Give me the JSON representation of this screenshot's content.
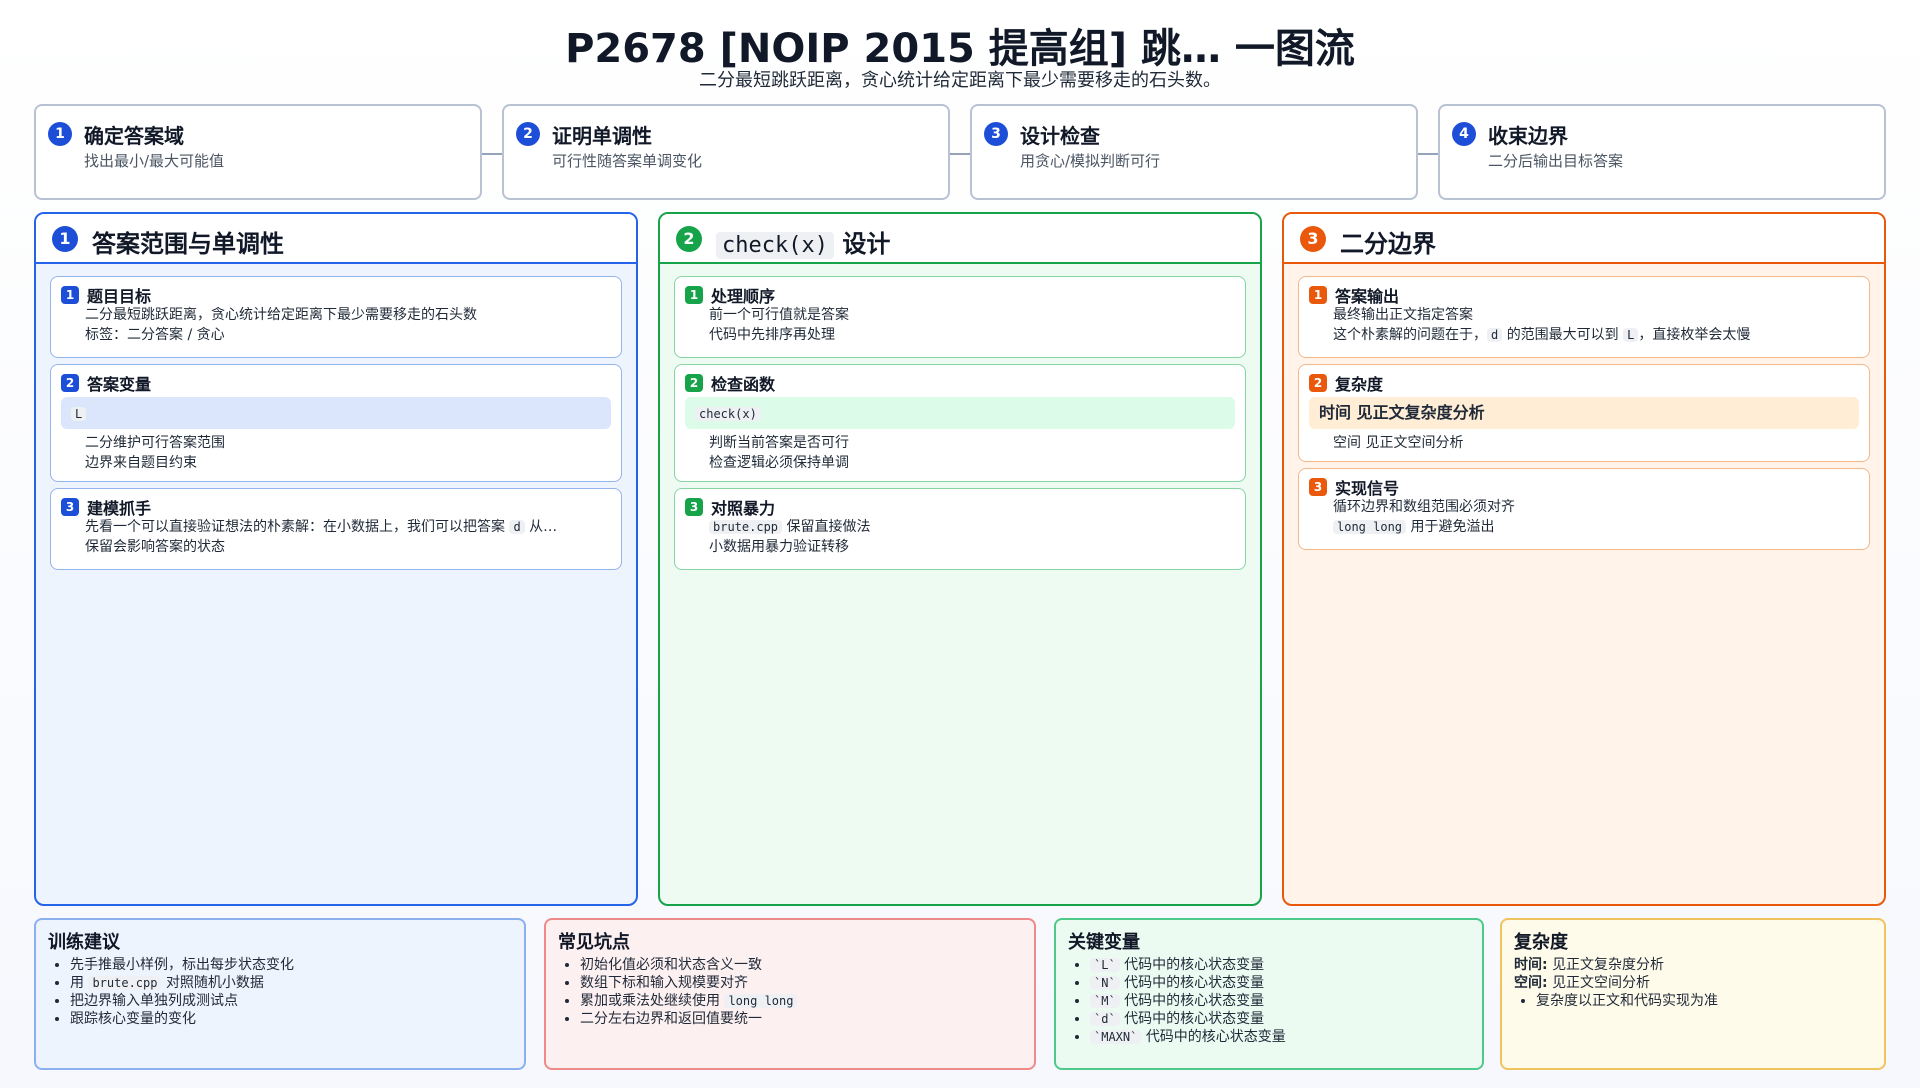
{
  "title": "P2678 [NOIP 2015 提高组] 跳… 一图流",
  "subtitle": "二分最短跳跃距离，贪心统计给定距离下最少需要移走的石头数。",
  "steps": [
    {
      "num": "1",
      "title": "确定答案域",
      "desc": "找出最小/最大可能值"
    },
    {
      "num": "2",
      "title": "证明单调性",
      "desc": "可行性随答案单调变化"
    },
    {
      "num": "3",
      "title": "设计检查",
      "desc": "用贪心/模拟判断可行"
    },
    {
      "num": "4",
      "title": "收束边界",
      "desc": "二分后输出目标答案"
    }
  ],
  "col1": {
    "num": "1",
    "title": "答案范围与单调性",
    "card1": {
      "num": "1",
      "title": "题目目标",
      "items": [
        "二分最短跳跃距离，贪心统计给定距离下最少需要移走的石头数",
        "标签：二分答案 / 贪心"
      ]
    },
    "card2": {
      "num": "2",
      "title": "答案变量",
      "code": "L",
      "items": [
        "二分维护可行答案范围",
        "边界来自题目约束"
      ]
    },
    "card3": {
      "num": "3",
      "title": "建模抓手",
      "item1_pre": "先看一个可以直接验证想法的朴素解：在小数据上，我们可以把答案",
      "item1_code": "d",
      "item1_post": "从…",
      "item2": "保留会影响答案的状态"
    }
  },
  "col2": {
    "num": "2",
    "title_code": "check(x)",
    "title_suffix": "设计",
    "card1": {
      "num": "1",
      "title": "处理顺序",
      "items": [
        "前一个可行值就是答案",
        "代码中先排序再处理"
      ]
    },
    "card2": {
      "num": "2",
      "title": "检查函数",
      "code": "check(x)",
      "items": [
        "判断当前答案是否可行",
        "检查逻辑必须保持单调"
      ]
    },
    "card3": {
      "num": "3",
      "title": "对照暴力",
      "item1_code": "brute.cpp",
      "item1_post": "保留直接做法",
      "item2": "小数据用暴力验证转移"
    }
  },
  "col3": {
    "num": "3",
    "title": "二分边界",
    "card1": {
      "num": "1",
      "title": "答案输出",
      "item1": "最终输出正文指定答案",
      "item2_pre": "这个朴素解的问题在于，",
      "item2_code1": "d",
      "item2_mid": "的范围最大可以到",
      "item2_code2": "L",
      "item2_post": "，直接枚举会太慢"
    },
    "card2": {
      "num": "2",
      "title": "复杂度",
      "highlight": "时间 见正文复杂度分析",
      "items": [
        "空间 见正文空间分析"
      ]
    },
    "card3": {
      "num": "3",
      "title": "实现信号",
      "item1": "循环边界和数组范围必须对齐",
      "item2_code": "long long",
      "item2_post": "用于避免溢出"
    }
  },
  "bottom": {
    "training": {
      "title": "训练建议",
      "item1": "先手推最小样例，标出每步状态变化",
      "item2_pre": "用",
      "item2_code": "brute.cpp",
      "item2_post": "对照随机小数据",
      "item3": "把边界输入单独列成测试点",
      "item4": "跟踪核心变量的变化"
    },
    "pitfalls": {
      "title": "常见坑点",
      "item1": "初始化值必须和状态含义一致",
      "item2": "数组下标和输入规模要对齐",
      "item3_pre": "累加或乘法处继续使用",
      "item3_code": "long long",
      "item4": "二分左右边界和返回值要统一"
    },
    "keyvars": {
      "title": "关键变量",
      "items": [
        {
          "code": "`L`",
          "desc": "代码中的核心状态变量"
        },
        {
          "code": "`N`",
          "desc": "代码中的核心状态变量"
        },
        {
          "code": "`M`",
          "desc": "代码中的核心状态变量"
        },
        {
          "code": "`d`",
          "desc": "代码中的核心状态变量"
        },
        {
          "code": "`MAXN`",
          "desc": "代码中的核心状态变量"
        }
      ]
    },
    "complexity": {
      "title": "复杂度",
      "time_label": "时间:",
      "time_value": "见正文复杂度分析",
      "space_label": "空间:",
      "space_value": "见正文空间分析",
      "item": "复杂度以正文和代码实现为准"
    }
  },
  "colors": {
    "blue": "#1d4ed8",
    "green": "#16a34a",
    "orange": "#ea580c"
  }
}
